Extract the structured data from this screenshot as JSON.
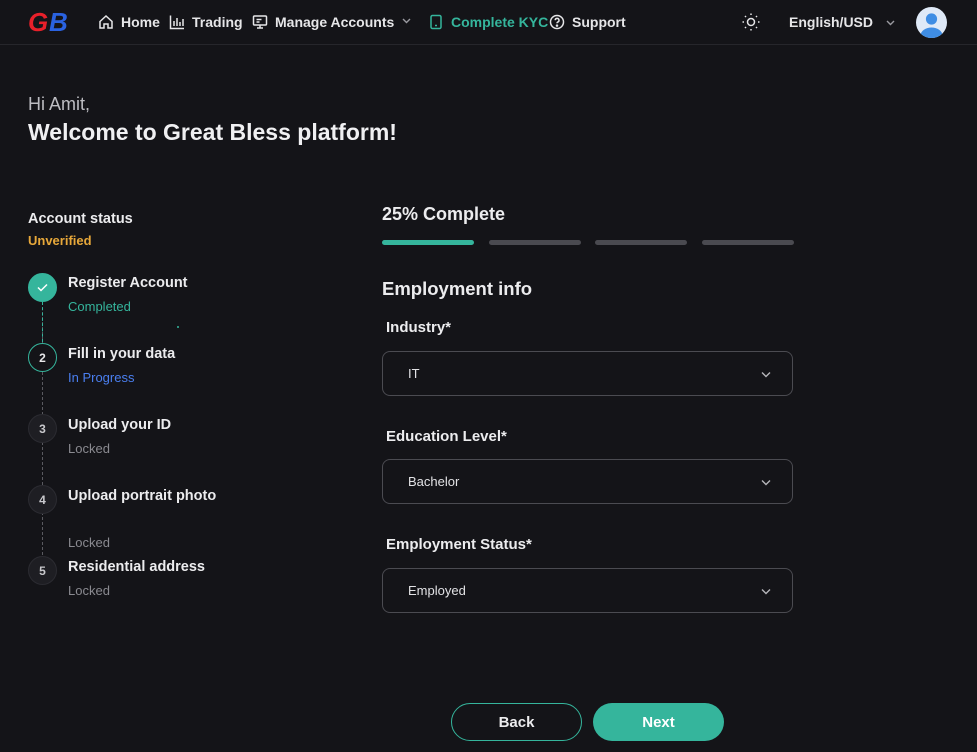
{
  "nav": {
    "logo": "GB",
    "items": [
      {
        "label": "Home",
        "icon": "home-icon"
      },
      {
        "label": "Trading",
        "icon": "chart-bars-icon"
      },
      {
        "label": "Manage Accounts",
        "icon": "monitor-icon"
      },
      {
        "label": "Complete KYC",
        "icon": "phone-icon"
      },
      {
        "label": "Support",
        "icon": "help-circle-icon"
      }
    ],
    "language": "English/USD",
    "accent_color": "#35b59c"
  },
  "greeting": {
    "hi": "Hi Amit,",
    "welcome": "Welcome to Great Bless platform!"
  },
  "account": {
    "status_label": "Account status",
    "status_value": "Unverified"
  },
  "steps": [
    {
      "num": "1",
      "title": "Register Account",
      "status": "Completed",
      "state": "done"
    },
    {
      "num": "2",
      "title": "Fill in your data",
      "status": "In Progress",
      "state": "current"
    },
    {
      "num": "3",
      "title": "Upload your ID",
      "status": "Locked",
      "state": "locked"
    },
    {
      "num": "4",
      "title": "Upload portrait photo",
      "status": "Locked",
      "state": "locked"
    },
    {
      "num": "5",
      "title": "Residential address",
      "status": "Locked",
      "state": "locked"
    }
  ],
  "progress": {
    "label": "25% Complete",
    "fraction": 0.25,
    "segments": 4,
    "filled": 1
  },
  "form": {
    "section_title": "Employment info",
    "fields": [
      {
        "label": "Industry*",
        "value": "IT"
      },
      {
        "label": "Education Level*",
        "value": "Bachelor"
      },
      {
        "label": "Employment Status*",
        "value": "Employed"
      }
    ]
  },
  "buttons": {
    "back": "Back",
    "next": "Next"
  }
}
